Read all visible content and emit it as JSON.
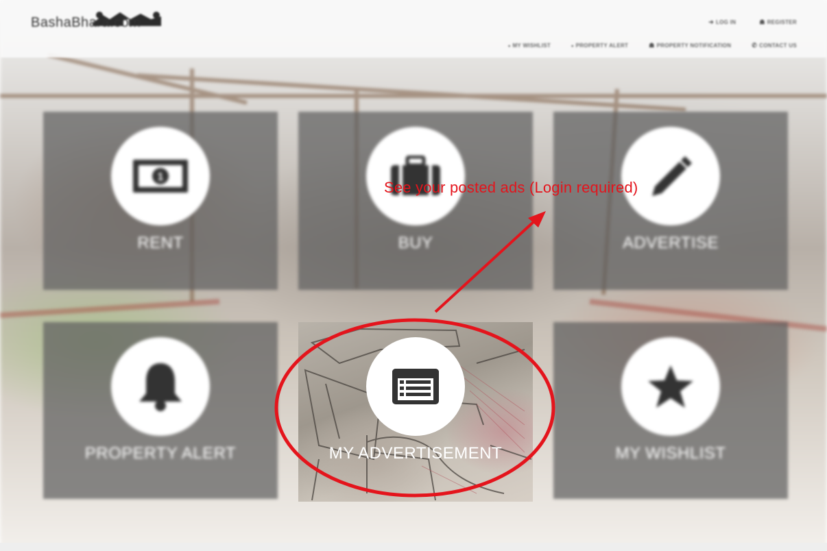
{
  "site": {
    "logo_text": "BashaBhara.com"
  },
  "header": {
    "nav_top": [
      {
        "label": "LOG IN",
        "icon": "login-icon",
        "glyph": "➜"
      },
      {
        "label": "REGISTER",
        "icon": "user-icon",
        "glyph": "☗"
      }
    ],
    "nav_bottom": [
      {
        "label": "MY WISHLIST",
        "icon": "wishlist-icon",
        "glyph": "▪"
      },
      {
        "label": "PROPERTY ALERT",
        "icon": "bell-icon",
        "glyph": "▪"
      },
      {
        "label": "PROPERTY NOTIFICATION",
        "icon": "user-icon",
        "glyph": "☗"
      },
      {
        "label": "CONTACT US",
        "icon": "phone-icon",
        "glyph": "✆"
      }
    ]
  },
  "tiles": [
    {
      "label": "RENT",
      "icon": "money-icon"
    },
    {
      "label": "BUY",
      "icon": "briefcase-icon"
    },
    {
      "label": "ADVERTISE",
      "icon": "pencil-icon"
    },
    {
      "label": "PROPERTY ALERT",
      "icon": "bell-icon"
    },
    {
      "label": "MY ADVERTISEMENT",
      "icon": "list-icon"
    },
    {
      "label": "MY WISHLIST",
      "icon": "star-icon"
    }
  ],
  "annotation": {
    "text": "See your posted ads (Login required)",
    "color": "#e4141c"
  },
  "colors": {
    "tile_bg": "#5f5f5f",
    "icon_color": "#333333",
    "annotation_red": "#e4141c"
  }
}
